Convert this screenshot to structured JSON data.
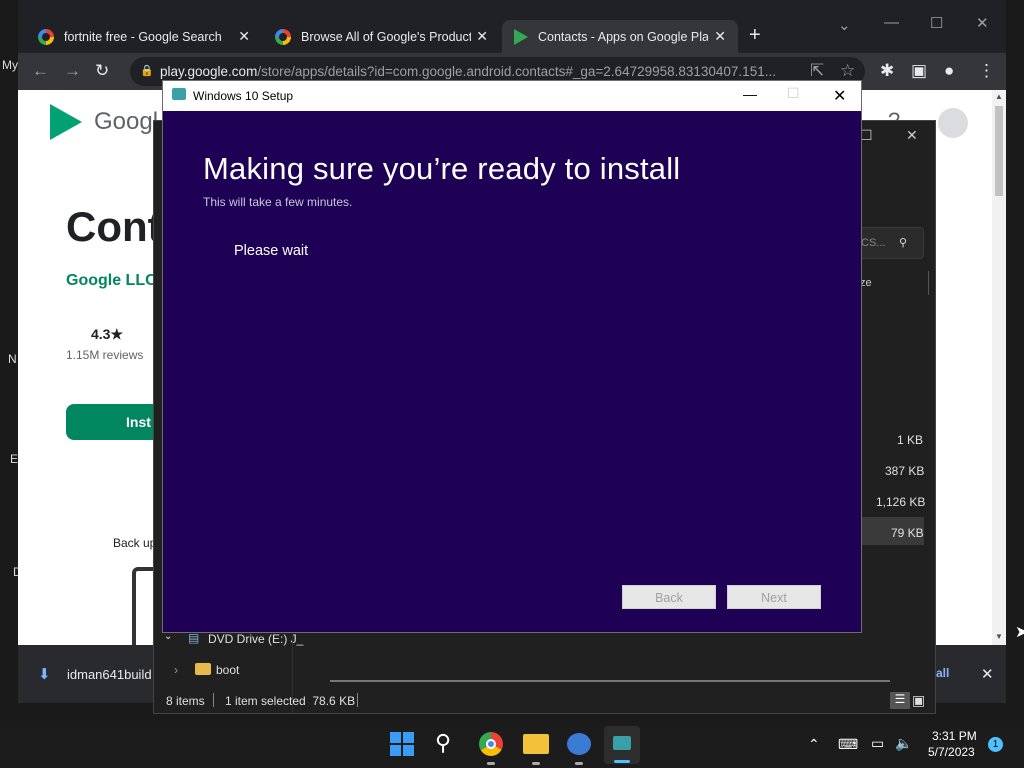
{
  "desktop": {
    "labels": [
      "My",
      "N",
      "E",
      "D"
    ]
  },
  "browser": {
    "tabs": [
      {
        "title": "fortnite free - Google Search",
        "icon": "google-g-icon"
      },
      {
        "title": "Browse All of Google's Products",
        "icon": "google-g-icon"
      },
      {
        "title": "Contacts - Apps on Google Play",
        "icon": "google-play-icon"
      }
    ],
    "new_tab": "+",
    "url_host": "play.google.com",
    "url_path": "/store/apps/details?id=com.google.android.contacts#_ga=2.64729958.83130407.151...",
    "page": {
      "logo_text": "Googl",
      "app_title": "Cont",
      "developer": "Google LLC",
      "rating": "4.3★",
      "reviews": "1.15M reviews",
      "install_label": "Inst",
      "backup_text": "Back up"
    },
    "download": {
      "filename": "idman641build",
      "show_all": "all",
      "close": "✕"
    }
  },
  "explorer": {
    "search_placeholder": "CS...",
    "size_header": "ze",
    "sizes": [
      "1 KB",
      "387 KB",
      "1,126 KB",
      "79 KB"
    ],
    "tree": [
      {
        "label": "DVD Drive (E:) J_"
      },
      {
        "label": "boot"
      }
    ],
    "status": {
      "items": "8 items",
      "selected": "1 item selected  78.6 KB"
    }
  },
  "setup": {
    "window_title": "Windows 10 Setup",
    "heading": "Making sure you’re ready to install",
    "subtitle": "This will take a few minutes.",
    "status": "Please wait",
    "back_label": "Back",
    "next_label": "Next"
  },
  "taskbar": {
    "time": "3:31 PM",
    "date": "5/7/2023",
    "notification_count": "1"
  },
  "colors": {
    "setup_bg": "#1e0054",
    "chrome_dark": "#202124",
    "play_green": "#01875f"
  }
}
